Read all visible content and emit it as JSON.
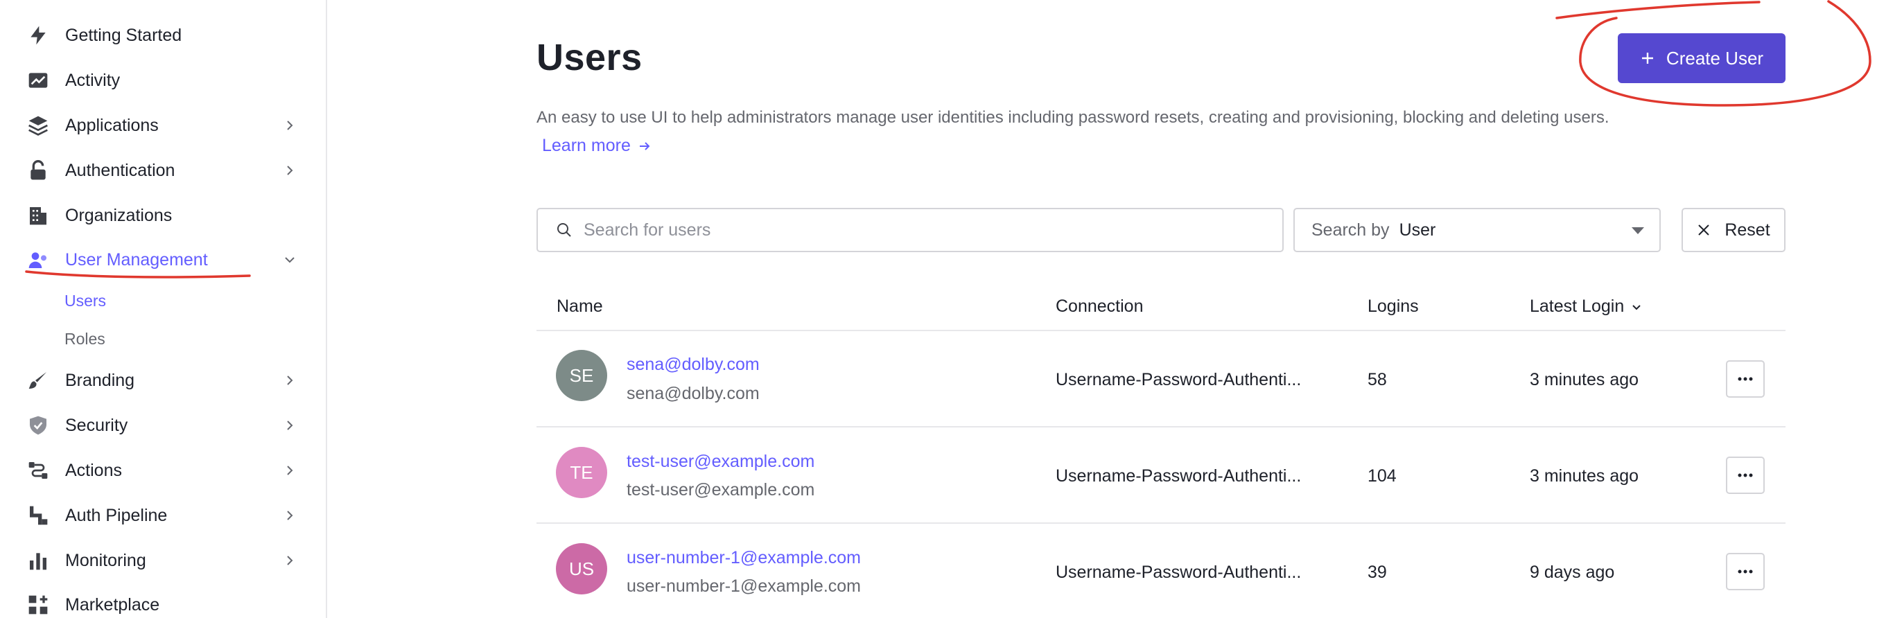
{
  "sidebar": {
    "items": [
      {
        "label": "Getting Started",
        "icon": "lightning-icon"
      },
      {
        "label": "Activity",
        "icon": "activity-chart-icon"
      },
      {
        "label": "Applications",
        "icon": "layers-icon"
      },
      {
        "label": "Authentication",
        "icon": "lock-icon"
      },
      {
        "label": "Organizations",
        "icon": "building-icon"
      },
      {
        "label": "User Management",
        "icon": "users-icon"
      },
      {
        "label": "Branding",
        "icon": "brush-icon"
      },
      {
        "label": "Security",
        "icon": "shield-icon"
      },
      {
        "label": "Actions",
        "icon": "flow-icon"
      },
      {
        "label": "Auth Pipeline",
        "icon": "pipeline-icon"
      },
      {
        "label": "Monitoring",
        "icon": "bar-chart-icon"
      },
      {
        "label": "Marketplace",
        "icon": "grid-plus-icon"
      }
    ],
    "sub_items": [
      {
        "label": "Users"
      },
      {
        "label": "Roles"
      }
    ]
  },
  "header": {
    "title": "Users",
    "description": "An easy to use UI to help administrators manage user identities including password resets, creating and provisioning, blocking and deleting users.",
    "learn_more": "Learn more",
    "create_button": "Create User"
  },
  "search": {
    "placeholder": "Search for users",
    "searchby_label": "Search by",
    "searchby_value": "User",
    "reset_label": "Reset"
  },
  "table": {
    "columns": [
      "Name",
      "Connection",
      "Logins",
      "Latest Login"
    ],
    "rows": [
      {
        "initials": "SE",
        "avatar_color": "#7d8b88",
        "email": "sena@dolby.com",
        "sub": "sena@dolby.com",
        "connection": "Username-Password-Authenti...",
        "logins": "58",
        "latest": "3 minutes ago"
      },
      {
        "initials": "TE",
        "avatar_color": "#e08ac2",
        "email": "test-user@example.com",
        "sub": "test-user@example.com",
        "connection": "Username-Password-Authenti...",
        "logins": "104",
        "latest": "3 minutes ago"
      },
      {
        "initials": "US",
        "avatar_color": "#cc6aa6",
        "email": "user-number-1@example.com",
        "sub": "user-number-1@example.com",
        "connection": "Username-Password-Authenti...",
        "logins": "39",
        "latest": "9 days ago"
      }
    ]
  },
  "colors": {
    "accent": "#635dff",
    "primary_button": "#5548d0",
    "annotation": "#e0382e"
  }
}
